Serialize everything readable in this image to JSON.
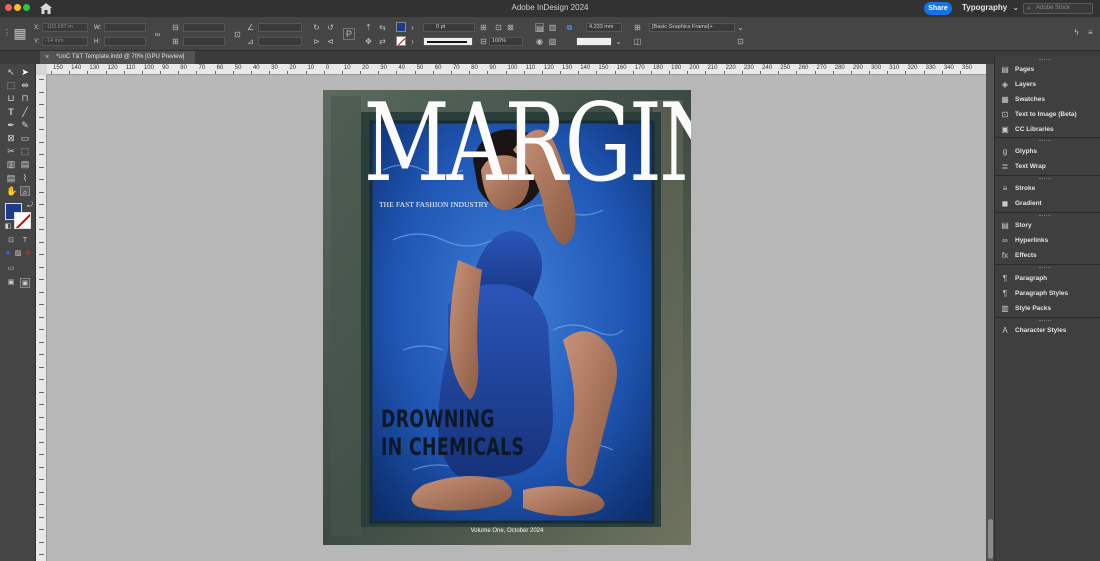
{
  "app": {
    "title": "Adobe InDesign 2024",
    "share_label": "Share",
    "workspace_label": "Typography",
    "workspace_arrow": "⌄",
    "stock_placeholder": "Adobe Stock"
  },
  "control_bar": {
    "x_label": "X:",
    "x_value": "-103.687 m",
    "y_label": "Y:",
    "y_value": "-14 mm",
    "w_label": "W:",
    "h_label": "H:",
    "stroke_weight": "0 pt",
    "scale_value": "100%",
    "gap_value": "4.233 mm",
    "object_style": "[Basic Graphics Frame]+",
    "fill_color": "#1e3a8a"
  },
  "document": {
    "tab_title": "*UoC T&T Template.indd @ 70% [GPU Preview]",
    "close_glyph": "×"
  },
  "ruler": {
    "labels": [
      "150",
      "140",
      "130",
      "120",
      "110",
      "100",
      "90",
      "80",
      "70",
      "60",
      "50",
      "40",
      "30",
      "20",
      "10",
      "0",
      "10",
      "20",
      "30",
      "40",
      "50",
      "60",
      "70",
      "80",
      "90",
      "100",
      "110",
      "120",
      "130",
      "140",
      "150",
      "160",
      "170",
      "180",
      "190",
      "200",
      "210",
      "220",
      "230",
      "240",
      "250",
      "260",
      "270",
      "280",
      "290",
      "300",
      "310",
      "320",
      "330",
      "340",
      "350"
    ]
  },
  "toolbox": {
    "fill_swatch": "#1e3a8a",
    "tools": [
      "selection-tool",
      "direct-selection-tool",
      "page-tool",
      "gap-tool",
      "content-collector-tool",
      "type-tool",
      "line-tool",
      "pen-tool",
      "pencil-tool",
      "rectangle-frame-tool",
      "rectangle-tool",
      "scissors-tool",
      "free-transform-tool",
      "gradient-swatch-tool",
      "gradient-feather-tool",
      "note-tool",
      "eyedropper-tool",
      "hand-tool",
      "zoom-tool"
    ]
  },
  "panels": {
    "items": [
      {
        "label": "Pages",
        "icon": "pages-icon",
        "glyph": "▤"
      },
      {
        "label": "Layers",
        "icon": "layers-icon",
        "glyph": "◈"
      },
      {
        "label": "Swatches",
        "icon": "swatches-icon",
        "glyph": "▦"
      },
      {
        "label": "Text to Image (Beta)",
        "icon": "text-to-image-icon",
        "glyph": "⊡"
      },
      {
        "label": "CC Libraries",
        "icon": "cc-libraries-icon",
        "glyph": "▣"
      },
      {
        "label": "Glyphs",
        "icon": "glyphs-icon",
        "glyph": "ɡ"
      },
      {
        "label": "Text Wrap",
        "icon": "text-wrap-icon",
        "glyph": "≣"
      },
      {
        "label": "Stroke",
        "icon": "stroke-icon",
        "glyph": "≡"
      },
      {
        "label": "Gradient",
        "icon": "gradient-icon",
        "glyph": "◼"
      },
      {
        "label": "Story",
        "icon": "story-icon",
        "glyph": "▤"
      },
      {
        "label": "Hyperlinks",
        "icon": "hyperlinks-icon",
        "glyph": "∞"
      },
      {
        "label": "Effects",
        "icon": "effects-icon",
        "glyph": "fx"
      },
      {
        "label": "Paragraph",
        "icon": "paragraph-icon",
        "glyph": "¶"
      },
      {
        "label": "Paragraph Styles",
        "icon": "paragraph-styles-icon",
        "glyph": "¶"
      },
      {
        "label": "Style Packs",
        "icon": "style-packs-icon",
        "glyph": "▥"
      },
      {
        "label": "Character Styles",
        "icon": "character-styles-icon",
        "glyph": "A"
      }
    ]
  },
  "cover": {
    "masthead": "MARGIN",
    "tagline": "THE FAST FASHION INDUSTRY",
    "headline_line1": "DROWNING",
    "headline_line2": "IN CHEMICALS",
    "issue": "Volume One, October 2024"
  }
}
